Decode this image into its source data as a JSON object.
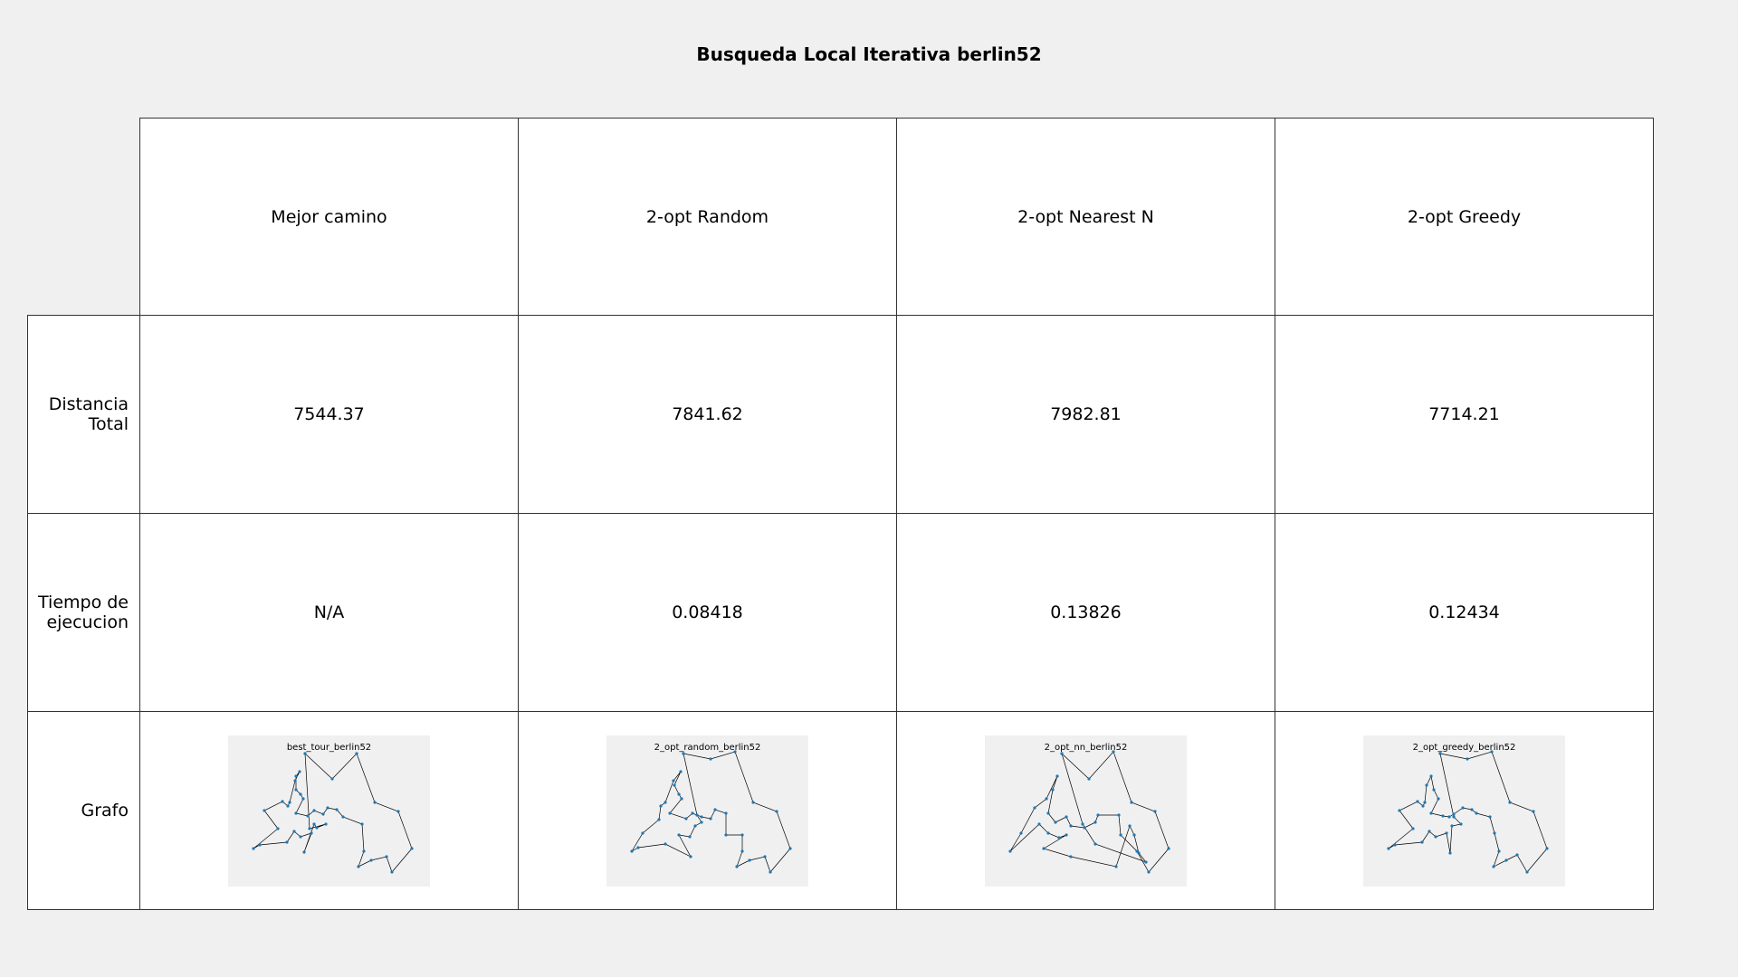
{
  "chart_data": {
    "type": "table",
    "title": "Busqueda Local Iterativa berlin52",
    "columns": [
      "Mejor camino",
      "2-opt Random",
      "2-opt Nearest N",
      "2-opt Greedy"
    ],
    "rows": [
      {
        "label": "Distancia Total",
        "cells": [
          "7544.37",
          "7841.62",
          "7982.81",
          "7714.21"
        ]
      },
      {
        "label": "Tiempo de ejecucion",
        "cells": [
          "N/A",
          "0.08418",
          "0.13826",
          "0.12434"
        ]
      },
      {
        "label": "Grafo",
        "thumbnails": [
          "best_tour_berlin52",
          "2_opt_random_berlin52",
          "2_opt_nn_berlin52",
          "2_opt_greedy_berlin52"
        ]
      }
    ],
    "colors": {
      "node": "#1f77b4",
      "edge": "#000000",
      "thumb_bg": "#f0f0f0"
    }
  },
  "row_labels": {
    "distance": [
      "Distancia",
      "Total"
    ],
    "time": [
      "Tiempo de",
      "ejecucion"
    ],
    "graph": "Grafo"
  }
}
